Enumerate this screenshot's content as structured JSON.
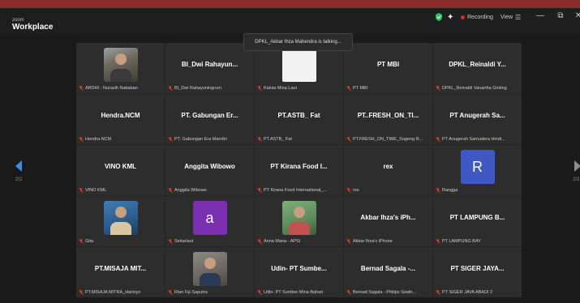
{
  "app": {
    "brand_small": "zoom",
    "brand_big": "Workplace"
  },
  "toolbar": {
    "recording_label": "Recording",
    "view_label": "View",
    "menu_glyph": "☰"
  },
  "window_controls": {
    "minimize": "—",
    "restore": "⧉",
    "close": "✕"
  },
  "toast": {
    "text": "DPKL_Akbar Ihza Mahendra is talking..."
  },
  "pagination": {
    "left": "2/2",
    "right": "2/2"
  },
  "colors": {
    "muted_mic": "#e03a2a",
    "avatar_purple": "#7a2fb0",
    "avatar_blue": "#3f58c4",
    "accent_green": "#2ec45a"
  },
  "participants": [
    {
      "name": "",
      "label": "ARDHI - Nurasih Nababan",
      "avatar": "photo"
    },
    {
      "name": "BI_Dwi Rahayun...",
      "label": "BI_Dwi Rahayuningrum"
    },
    {
      "name": "",
      "label": "Kaloia Mina Laut",
      "avatar": "blank"
    },
    {
      "name": "PT MBI",
      "label": "PT MBI"
    },
    {
      "name": "DPKL_Reinaldi Y...",
      "label": "DPKL_Reinaldi Vanartha Ginting"
    },
    {
      "name": "Hendra.NCM",
      "label": "Hendra.NCM"
    },
    {
      "name": "PT. Gabungan Er...",
      "label": "PT. Gabungan Era Mandiri"
    },
    {
      "name": "PT.ASTB_ Fat",
      "label": "PT.ASTB_ Fat"
    },
    {
      "name": "PT..FRESH_ON_TI...",
      "label": "PT.FRESH_ON_TIME_Sugeng R..."
    },
    {
      "name": "PT Anugerah Sa...",
      "label": "PT Anugerah Samudera Hindi..."
    },
    {
      "name": "VINO KML",
      "label": "VINO KML"
    },
    {
      "name": "Anggita Wibowo",
      "label": "Anggita Wibowo"
    },
    {
      "name": "PT Kirana Food I...",
      "label": "PT Kirana Food International_..."
    },
    {
      "name": "rex",
      "label": "rex"
    },
    {
      "name": "",
      "label": "Rangga",
      "avatar": "letter",
      "letter": "R"
    },
    {
      "name": "",
      "label": "Gita",
      "avatar": "photo"
    },
    {
      "name": "",
      "label": "Sekarlaut",
      "avatar": "letter",
      "letter": "a"
    },
    {
      "name": "",
      "label": "Anna Mana - APSI",
      "avatar": "photo"
    },
    {
      "name": "Akbar Ihza's iPh...",
      "label": "Akbar Ihza's iPhone"
    },
    {
      "name": "PT LAMPUNG B...",
      "label": "PT LAMPUNG BAY"
    },
    {
      "name": "PT.MISAJA MIT...",
      "label": "PT.MISAJA MITRA_Hartoyo"
    },
    {
      "name": "",
      "label": "Rian Fiji Saputra",
      "avatar": "photo"
    },
    {
      "name": "Udin- PT Sumbe...",
      "label": "Udin- PT Sumber Mina Bahari"
    },
    {
      "name": "Bernad Sagala -...",
      "label": "Bernad Sagala - Philips Seafo..."
    },
    {
      "name": "PT SIGER JAYA...",
      "label": "PT SIGER JAVA ABADI 2"
    }
  ]
}
